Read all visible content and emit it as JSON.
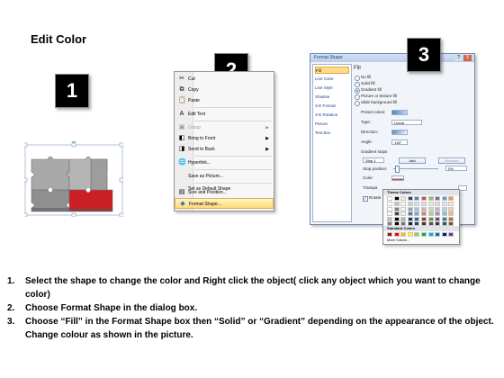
{
  "title": "Edit Color",
  "badges": [
    "1",
    "2",
    "3"
  ],
  "context_menu": {
    "items": [
      {
        "label": "Cut",
        "icon": "scissors-icon",
        "glyph": "✂",
        "arrow": false,
        "disabled": false
      },
      {
        "label": "Copy",
        "icon": "copy-icon",
        "glyph": "⧉",
        "arrow": false,
        "disabled": false
      },
      {
        "label": "Paste",
        "icon": "paste-icon",
        "glyph": "📋",
        "arrow": false,
        "disabled": false
      },
      {
        "label": "Edit Text",
        "icon": "edit-text-icon",
        "glyph": "A",
        "arrow": false,
        "disabled": false
      },
      {
        "label": "Group",
        "icon": "group-icon",
        "glyph": "▣",
        "arrow": true,
        "disabled": true
      },
      {
        "label": "Bring to Front",
        "icon": "bring-front-icon",
        "glyph": "◧",
        "arrow": true,
        "disabled": false
      },
      {
        "label": "Send to Back",
        "icon": "send-back-icon",
        "glyph": "◨",
        "arrow": true,
        "disabled": false
      },
      {
        "label": "Hyperlink...",
        "icon": "hyperlink-icon",
        "glyph": "🌐",
        "arrow": false,
        "disabled": false
      },
      {
        "label": "Save as Picture...",
        "icon": "",
        "glyph": "",
        "arrow": false,
        "disabled": false
      },
      {
        "label": "Set as Default Shape",
        "icon": "",
        "glyph": "",
        "arrow": false,
        "disabled": false
      },
      {
        "label": "Size and Position...",
        "icon": "size-position-icon",
        "glyph": "▤",
        "arrow": false,
        "disabled": false
      },
      {
        "label": "Format Shape...",
        "icon": "format-shape-icon",
        "glyph": "◆",
        "arrow": false,
        "disabled": false
      }
    ]
  },
  "dialog": {
    "title": "Format Shape",
    "help": "?",
    "close": "X",
    "nav": [
      "Fill",
      "Line Color",
      "Line Style",
      "Shadow",
      "3-D Format",
      "3-D Rotation",
      "Picture",
      "Text Box"
    ],
    "section": "Fill",
    "radios": [
      "No fill",
      "Solid fill",
      "Gradient fill",
      "Picture or texture fill",
      "Slide background fill"
    ],
    "selected_radio": 2,
    "preset_colors_label": "Preset colors:",
    "type_label": "Type:",
    "type_value": "Linear",
    "direction_label": "Direction:",
    "angle_label": "Angle:",
    "angle_value": "135°",
    "gradient_stops_label": "Gradient stops",
    "stop_value": "Stop 1",
    "add_label": "Add",
    "remove_label": "Remove",
    "stop_position_label": "Stop position:",
    "stop_position_value": "0%",
    "color_label": "Color:",
    "transparency_label": "Transpa",
    "rotate_label": "Rotate"
  },
  "palette": {
    "theme_label": "Theme Colors",
    "standard_label": "Standard Colors",
    "more_label": "More Colors...",
    "theme_top": [
      "#ffffff",
      "#000000",
      "#eeece1",
      "#1f497d",
      "#4f81bd",
      "#c0504d",
      "#9bbb59",
      "#8064a2",
      "#4bacc6",
      "#f79646"
    ],
    "standard": [
      "#c00000",
      "#ff0000",
      "#ffc000",
      "#ffff00",
      "#92d050",
      "#00b050",
      "#00b0f0",
      "#0070c0",
      "#002060",
      "#7030a0"
    ]
  },
  "steps": [
    {
      "n": "1.",
      "text": "Select the shape to change the color and Right click the object( click any object which you want to change color)"
    },
    {
      "n": "2.",
      "text": "Choose Format Shape in the dialog box."
    },
    {
      "n": "3.",
      "text": "Choose “Fill” in the Format Shape box then “Solid” or “Gradient” depending on the appearance of the object. Change colour as shown in the picture."
    }
  ]
}
